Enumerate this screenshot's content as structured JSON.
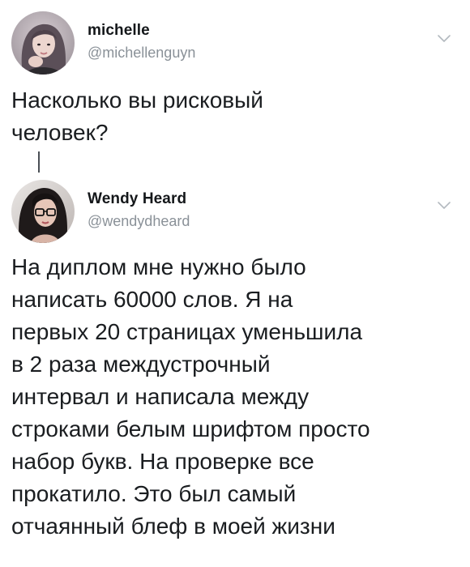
{
  "tweets": [
    {
      "author_name": "michelle",
      "author_handle": "@michellenguyn",
      "text": "Насколько вы рисковый\nчеловек?"
    },
    {
      "author_name": "Wendy Heard",
      "author_handle": "@wendydheard",
      "text": "На диплом мне нужно было\nнаписать 60000 слов. Я на\nпервых 20 страницах уменьшила\nв 2 раза междустрочный\nинтервал и написала между\nстроками белым шрифтом просто\nнабор букв. На проверке все\nпрокатило. Это был самый\nотчаянный блеф в моей жизни"
    }
  ],
  "icons": {
    "menu": "chevron-down-icon"
  },
  "colors": {
    "text": "#14171a",
    "secondary": "#8a9198",
    "thread": "#4a4f55"
  }
}
